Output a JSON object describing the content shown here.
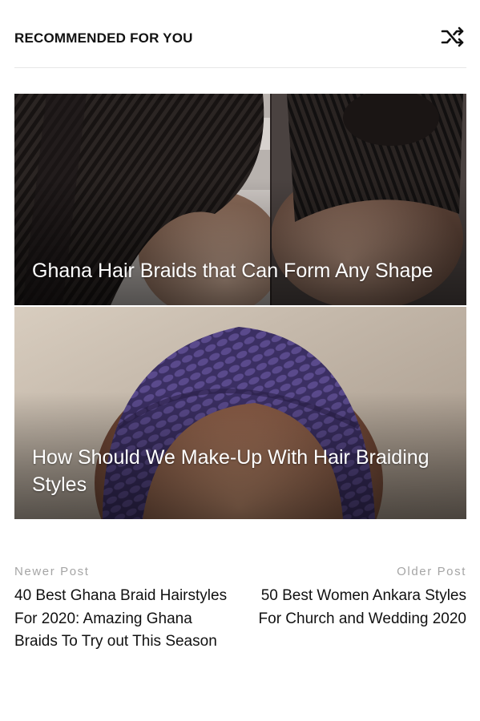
{
  "widget": {
    "title": "RECOMMENDED FOR YOU",
    "shuffle_icon": "shuffle-icon"
  },
  "cards": [
    {
      "title": "Ghana Hair Braids that Can Form Any Shape"
    },
    {
      "title": "How Should We Make-Up With Hair Braiding Styles"
    }
  ],
  "post_nav": {
    "newer": {
      "label": "Newer Post",
      "title": "40 Best Ghana Braid Hairstyles For 2020: Amazing Ghana Braids To Try out This Season"
    },
    "older": {
      "label": "Older Post",
      "title": "50 Best Women Ankara Styles For Church and Wedding 2020"
    }
  },
  "colors": {
    "text": "#111111",
    "muted": "#a5a5a5",
    "divider": "#e6e6e6",
    "overlay_text": "#ffffff"
  }
}
